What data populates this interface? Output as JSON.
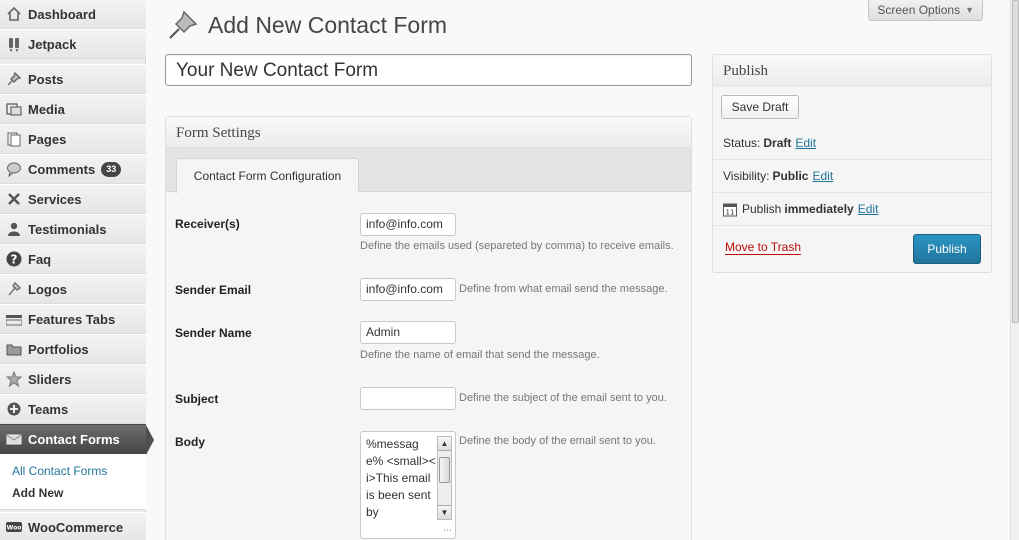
{
  "sidebar": {
    "items": [
      {
        "label": "Dashboard",
        "icon": "house-icon"
      },
      {
        "label": "Jetpack",
        "icon": "jetpack-icon"
      },
      {
        "label": "Posts",
        "icon": "pin-icon"
      },
      {
        "label": "Media",
        "icon": "media-icon"
      },
      {
        "label": "Pages",
        "icon": "pages-icon"
      },
      {
        "label": "Comments",
        "icon": "speech-bubble-icon",
        "badge": "33"
      },
      {
        "label": "Services",
        "icon": "tools-icon"
      },
      {
        "label": "Testimonials",
        "icon": "user-icon"
      },
      {
        "label": "Faq",
        "icon": "question-icon"
      },
      {
        "label": "Logos",
        "icon": "wrench-icon"
      },
      {
        "label": "Features Tabs",
        "icon": "tabs-icon"
      },
      {
        "label": "Portfolios",
        "icon": "folder-icon"
      },
      {
        "label": "Sliders",
        "icon": "star-icon"
      },
      {
        "label": "Teams",
        "icon": "plus-circle-icon"
      },
      {
        "label": "Contact Forms",
        "icon": "envelope-icon"
      },
      {
        "label": "WooCommerce",
        "icon": "woo-icon"
      }
    ],
    "submenu": [
      "All Contact Forms",
      "Add New"
    ]
  },
  "header": {
    "screen_options": "Screen Options",
    "title": "Add New Contact Form"
  },
  "title_field": {
    "value": "Your New Contact Form"
  },
  "form_settings": {
    "heading": "Form Settings",
    "tab": "Contact Form Configuration",
    "fields": {
      "receivers": {
        "label": "Receiver(s)",
        "value": "info@info.com",
        "help": "Define the emails used (separeted by comma) to receive emails."
      },
      "sender_email": {
        "label": "Sender Email",
        "value": "info@info.com",
        "help": "Define from what email send the message."
      },
      "sender_name": {
        "label": "Sender Name",
        "value": "Admin",
        "help": "Define the name of email that send the message."
      },
      "subject": {
        "label": "Subject",
        "value": "",
        "help": "Define the subject of the email sent to you."
      },
      "body": {
        "label": "Body",
        "value": "%message% <small><i>This email is been sent by",
        "help": "Define the body of the email sent to you."
      }
    }
  },
  "publish": {
    "heading": "Publish",
    "save_draft": "Save Draft",
    "status_label": "Status:",
    "status_value": "Draft",
    "visibility_label": "Visibility:",
    "visibility_value": "Public",
    "publish_label": "Publish",
    "publish_value": "immediately",
    "edit": "Edit",
    "trash": "Move to Trash",
    "publish_button": "Publish"
  }
}
